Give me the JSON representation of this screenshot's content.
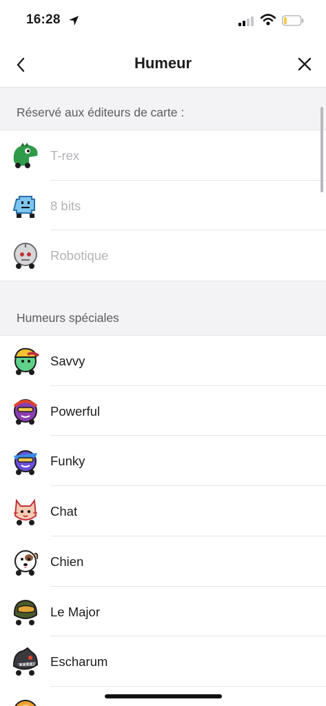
{
  "status_bar": {
    "time": "16:28"
  },
  "nav": {
    "title": "Humeur",
    "back_icon": "chevron-left-icon",
    "close_icon": "close-icon"
  },
  "sections": [
    {
      "header": "Réservé aux éditeurs de carte :",
      "items": [
        {
          "label": "T-rex",
          "icon": "t-rex-icon",
          "disabled": true
        },
        {
          "label": "8 bits",
          "icon": "8-bits-icon",
          "disabled": true
        },
        {
          "label": "Robotique",
          "icon": "robot-icon",
          "disabled": true
        }
      ]
    },
    {
      "header": "Humeurs spéciales",
      "items": [
        {
          "label": "Savvy",
          "icon": "savvy-icon"
        },
        {
          "label": "Powerful",
          "icon": "powerful-icon"
        },
        {
          "label": "Funky",
          "icon": "funky-icon"
        },
        {
          "label": "Chat",
          "icon": "cat-icon"
        },
        {
          "label": "Chien",
          "icon": "dog-icon"
        },
        {
          "label": "Le Major",
          "icon": "major-icon"
        },
        {
          "label": "Escharum",
          "icon": "escharum-icon"
        },
        {
          "label": "",
          "icon": "lion-icon"
        }
      ]
    }
  ],
  "colors": {
    "t_rex": "#2f9a4a",
    "eight_bits": "#7cc6ef",
    "robot": "#d7d7d9",
    "savvy": "#5fd08a",
    "savvy_cap": "#f3c233",
    "powerful": "#8a3db0",
    "funky": "#6a4ed8",
    "cat": "#f6c9b2",
    "dog": "#ffffff",
    "major": "#4a5a2a",
    "escharum": "#3a3a3e",
    "lion": "#f0a030"
  }
}
